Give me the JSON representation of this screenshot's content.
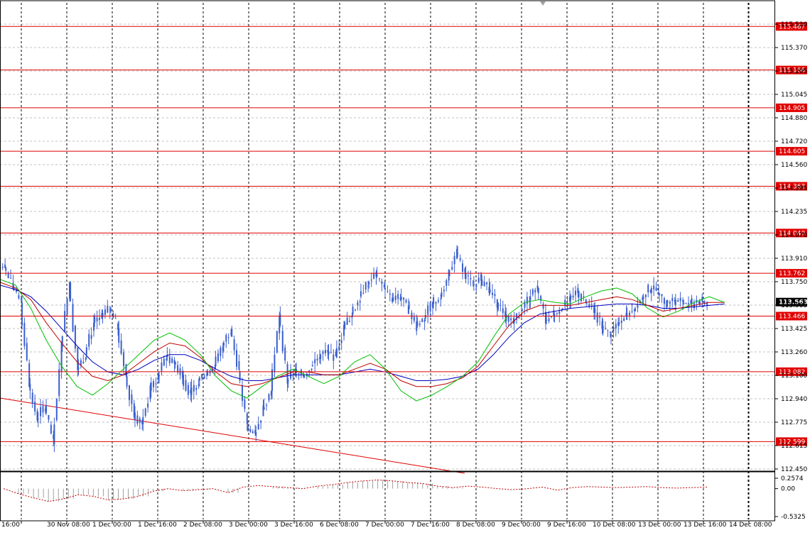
{
  "chart_data": {
    "type": "candlestick",
    "y_axis": {
      "ticks": [
        "115.530",
        "115.370",
        "115.205",
        "115.045",
        "114.880",
        "114.720",
        "114.560",
        "114.395",
        "114.235",
        "114.070",
        "113.910",
        "113.750",
        "113.585",
        "113.425",
        "113.260",
        "113.100",
        "112.940",
        "112.775",
        "112.615",
        "112.450"
      ],
      "ylim": [
        112.4,
        115.63
      ]
    },
    "x_axis": {
      "labels": [
        "16:00",
        "30 Nov 08:00",
        "1 Dec 00:00",
        "1 Dec 16:00",
        "2 Dec 08:00",
        "3 Dec 00:00",
        "3 Dec 16:00",
        "6 Dec 08:00",
        "7 Dec 00:00",
        "7 Dec 16:00",
        "8 Dec 08:00",
        "9 Dec 00:00",
        "9 Dec 16:00",
        "10 Dec 08:00",
        "13 Dec 00:00",
        "13 Dec 16:00",
        "14 Dec 08:00"
      ]
    },
    "price_levels": [
      {
        "value": 115.467,
        "label": "115.467"
      },
      {
        "value": 115.166,
        "label": "115.166"
      },
      {
        "value": 114.905,
        "label": "114.905"
      },
      {
        "value": 114.605,
        "label": "114.605"
      },
      {
        "value": 114.363,
        "label": "114.363"
      },
      {
        "value": 114.04,
        "label": "114.040"
      },
      {
        "value": 113.762,
        "label": "113.762"
      },
      {
        "value": 113.466,
        "label": "113.466"
      },
      {
        "value": 113.082,
        "label": "113.082"
      },
      {
        "value": 112.599,
        "label": "112.599"
      }
    ],
    "current_price": {
      "value": 113.563,
      "label": "113.563"
    },
    "close_series": [
      113.8,
      113.66,
      113.56,
      113.0,
      112.75,
      112.85,
      112.58,
      113.25,
      113.7,
      113.1,
      113.2,
      113.42,
      113.46,
      113.52,
      113.38,
      113.05,
      112.8,
      112.72,
      112.95,
      113.05,
      113.2,
      113.15,
      113.06,
      112.92,
      113.02,
      113.08,
      113.12,
      113.26,
      113.38,
      113.08,
      112.7,
      112.64,
      112.82,
      112.95,
      113.48,
      113.02,
      113.08,
      113.05,
      113.12,
      113.2,
      113.22,
      113.18,
      113.38,
      113.48,
      113.6,
      113.7,
      113.75,
      113.66,
      113.57,
      113.6,
      113.52,
      113.4,
      113.45,
      113.55,
      113.6,
      113.75,
      113.9,
      113.76,
      113.68,
      113.72,
      113.65,
      113.56,
      113.48,
      113.42,
      113.5,
      113.6,
      113.66,
      113.44,
      113.48,
      113.52,
      113.58,
      113.64,
      113.56,
      113.52,
      113.4,
      113.34,
      113.42,
      113.48,
      113.52,
      113.6,
      113.66,
      113.62,
      113.56,
      113.58,
      113.56,
      113.55,
      113.57,
      113.56
    ],
    "sma_fast": [
      113.72,
      113.68,
      113.52,
      113.3,
      113.12,
      112.98,
      112.92,
      113.0,
      113.1,
      113.2,
      113.3,
      113.35,
      113.3,
      113.2,
      113.05,
      112.95,
      112.9,
      112.98,
      113.05,
      113.1,
      113.05,
      113.0,
      113.05,
      113.15,
      113.2,
      113.1,
      112.95,
      112.88,
      112.92,
      112.98,
      113.05,
      113.15,
      113.32,
      113.48,
      113.56,
      113.58,
      113.56,
      113.55,
      113.6,
      113.64,
      113.66,
      113.62,
      113.52,
      113.46,
      113.5,
      113.56,
      113.6,
      113.56
    ],
    "sma_mid": [
      113.7,
      113.66,
      113.58,
      113.42,
      113.28,
      113.15,
      113.05,
      113.02,
      113.06,
      113.14,
      113.22,
      113.28,
      113.26,
      113.18,
      113.08,
      113.0,
      112.98,
      113.0,
      113.04,
      113.08,
      113.08,
      113.06,
      113.06,
      113.1,
      113.14,
      113.1,
      113.02,
      112.98,
      112.98,
      113.0,
      113.04,
      113.12,
      113.26,
      113.4,
      113.5,
      113.54,
      113.54,
      113.54,
      113.56,
      113.58,
      113.6,
      113.58,
      113.54,
      113.5,
      113.52,
      113.54,
      113.56,
      113.56
    ],
    "sma_slow": [
      113.68,
      113.65,
      113.6,
      113.5,
      113.38,
      113.26,
      113.15,
      113.08,
      113.06,
      113.1,
      113.16,
      113.2,
      113.2,
      113.16,
      113.1,
      113.05,
      113.02,
      113.02,
      113.04,
      113.06,
      113.06,
      113.06,
      113.06,
      113.08,
      113.1,
      113.08,
      113.05,
      113.02,
      113.02,
      113.03,
      113.05,
      113.1,
      113.2,
      113.32,
      113.42,
      113.48,
      113.5,
      113.52,
      113.53,
      113.54,
      113.55,
      113.55,
      113.54,
      113.52,
      113.52,
      113.53,
      113.54,
      113.55
    ],
    "oscillator": {
      "ticks": [
        "0.2574",
        "0.00",
        "-0.5325"
      ],
      "ylim": [
        -0.6,
        0.3
      ],
      "values": [
        0.0,
        -0.1,
        -0.18,
        -0.25,
        -0.2,
        -0.12,
        -0.15,
        -0.22,
        -0.2,
        -0.15,
        -0.05,
        0.0,
        -0.04,
        -0.02,
        0.0,
        -0.08,
        0.03,
        0.06,
        0.04,
        0.02,
        0.0,
        0.05,
        0.08,
        0.12,
        0.15,
        0.17,
        0.15,
        0.12,
        0.1,
        0.05,
        0.02,
        0.05,
        0.03,
        0.0,
        -0.02,
        0.0,
        0.03,
        -0.03,
        0.02,
        0.04,
        0.03,
        0.02,
        0.03,
        0.04,
        0.02,
        0.01,
        0.02,
        0.03
      ]
    },
    "trendline": {
      "start": {
        "x_index": 0,
        "y": 112.9
      },
      "end": {
        "x_index": 8.5,
        "y": 112.4
      }
    },
    "colors": {
      "candle": "#3a5fcd",
      "level_line": "#e00000",
      "level_label_bg": "#e00000",
      "current_label_bg": "#000000",
      "sma_fast": "#00c000",
      "sma_mid": "#c00000",
      "sma_slow": "#0000c0",
      "grid": "#c0c0c0",
      "vertical_separator": "#000000",
      "oscillator_bar": "#a0a0a0",
      "oscillator_line": "#c00000"
    }
  }
}
